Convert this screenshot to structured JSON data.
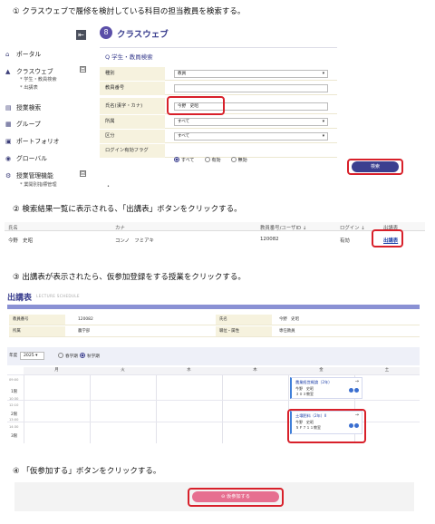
{
  "steps": {
    "s1": "① クラスウェブで履修を検討している科目の担当教員を検索する。",
    "s2": "② 検索結果一覧に表示される、「出講表」ボタンをクリックする。",
    "s3": "③ 出講表が表示されたら、仮参加登録をする授業をクリックする。",
    "s4": "④ 「仮参加する」ボタンをクリックする。"
  },
  "sidebar": {
    "collapse": "⇤",
    "items": [
      {
        "icon": "home-icon",
        "glyph": "⌂",
        "label": "ポータル"
      },
      {
        "icon": "graduation-cap-icon",
        "glyph": "🎓",
        "label": "クラスウェブ"
      },
      {
        "icon": "book-icon",
        "glyph": "▤",
        "label": "授業検索"
      },
      {
        "icon": "group-icon",
        "glyph": "▦",
        "label": "グループ"
      },
      {
        "icon": "portfolio-icon",
        "glyph": "▣",
        "label": "ポートフォリオ"
      },
      {
        "icon": "globe-icon",
        "glyph": "◉",
        "label": "グローバル"
      },
      {
        "icon": "gear-icon",
        "glyph": "⚙",
        "label": "授業管理機能"
      }
    ],
    "subitems": {
      "cw1": "* 学生・教員検索",
      "cw2": "* 出講表",
      "mgmt1": "* 業開別指標管理"
    },
    "toggle": "⊟"
  },
  "classweb": {
    "logo": "8",
    "title": "クラスウェブ"
  },
  "search": {
    "title": "Q 学生・教員検索",
    "fields": [
      {
        "label": "種別",
        "value": "教員",
        "select": true
      },
      {
        "label": "教員番号",
        "value": "",
        "select": false
      },
      {
        "label": "氏名(漢字・カナ)",
        "value": "今野　史昭",
        "select": false
      },
      {
        "label": "所属",
        "value": "すべて",
        "select": true
      },
      {
        "label": "区分",
        "value": "すべて",
        "select": true
      }
    ],
    "flag_label": "ログイン有効フラグ",
    "flag_options": [
      "すべて",
      "有効",
      "無効"
    ],
    "flag_selected": 0,
    "button": "検索"
  },
  "results": {
    "headers": [
      "氏名",
      "カナ",
      "教員番号/ユーザID ↓",
      "ログイン ↓",
      "出講表"
    ],
    "rows": [
      {
        "name": "今野　史昭",
        "kana": "コンノ　フミアキ",
        "id": "120082",
        "login": "有効",
        "link": "出講表"
      }
    ]
  },
  "schedule": {
    "title": "出講表",
    "subtitle": "LECTURE SCHEDULE",
    "info": {
      "num_label": "教員番号",
      "num": "120082",
      "name_label": "氏名",
      "name": "今野　史昭",
      "dept_label": "所属",
      "dept": "農学部",
      "rank_label": "職位・属性",
      "rank": "専任教員"
    },
    "year_label": "年度",
    "year": "2025",
    "terms": [
      "春学期",
      "秋学期"
    ],
    "term_selected": 1,
    "days": [
      "月",
      "火",
      "水",
      "木",
      "金",
      "土"
    ],
    "times": [
      "09:00",
      "10:30",
      "12:10",
      "13:00",
      "14:30"
    ],
    "periods": [
      "1限",
      "2限",
      "3限"
    ],
    "cards": [
      {
        "title": "農業経営概論（2年）",
        "teacher": "今野　史昭",
        "room": "３０３教室"
      },
      {
        "title": "土壌肥料（2年）Ⅱ",
        "teacher": "今野　史昭",
        "room": "５Ｆ７１１教室"
      }
    ]
  },
  "tentative_button": "⊖ 仮参加する"
}
